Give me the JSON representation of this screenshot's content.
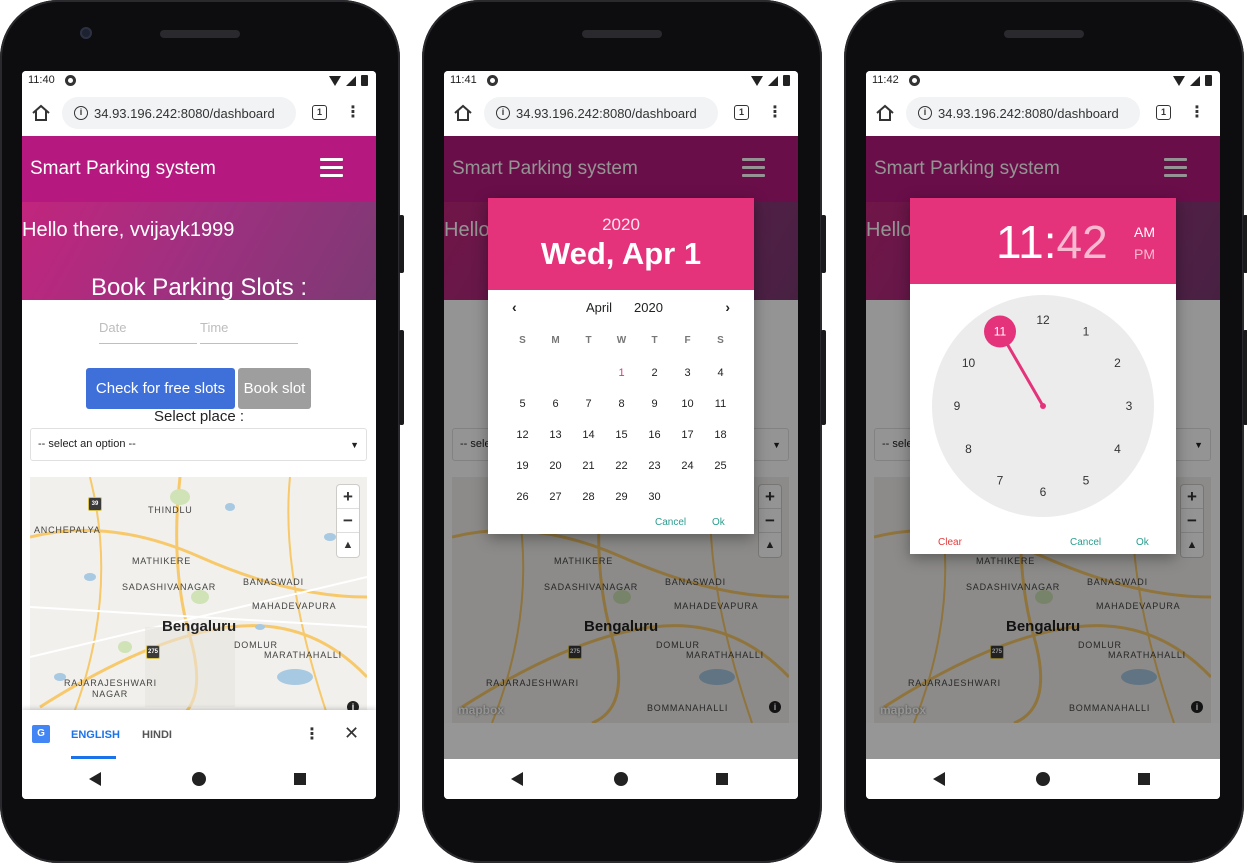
{
  "status_times": [
    "11:40",
    "11:41",
    "11:42"
  ],
  "browser": {
    "url": "34.93.196.242:8080/dashboard",
    "tab_count": "1"
  },
  "app": {
    "title": "Smart Parking system",
    "greeting": "Hello there, vvijayk1999",
    "greeting_partial": "Hello",
    "book_title": "Book Parking Slots :",
    "date_placeholder": "Date",
    "time_placeholder": "Time",
    "check_button": "Check for free slots",
    "book_button": "Book slot",
    "select_label": "Select place :",
    "select_value": "-- select an option --",
    "select_value_partial": "-- sele"
  },
  "map": {
    "city": "Bengaluru",
    "labels": [
      "ANCHEPALYA",
      "THINDLU",
      "MATHIKERE",
      "SADASHIVANAGAR",
      "BANASWADI",
      "MAHADEVAPURA",
      "DOMLUR",
      "MARATHAHALLI",
      "RAJARAJESHWARI",
      "NAGAR",
      "BOMMANAHALLI"
    ],
    "shields": [
      "39",
      "275"
    ],
    "attribution": "mapbox",
    "zoom_in": "+",
    "zoom_out": "−",
    "compass": "▲",
    "info": "i",
    "colors": {
      "water": "#a8c9e2",
      "road_major": "#f7c96a",
      "park": "#cfe3b6"
    }
  },
  "translate": {
    "english": "ENGLISH",
    "hindi": "HINDI"
  },
  "datepicker": {
    "year": "2020",
    "date": "Wed, Apr 1",
    "month": "April",
    "year_select": "2020",
    "weekdays": [
      "S",
      "M",
      "T",
      "W",
      "T",
      "F",
      "S"
    ],
    "days": [
      "",
      "",
      "",
      "1",
      "2",
      "3",
      "4",
      "5",
      "6",
      "7",
      "8",
      "9",
      "10",
      "11",
      "12",
      "13",
      "14",
      "15",
      "16",
      "17",
      "18",
      "19",
      "20",
      "21",
      "22",
      "23",
      "24",
      "25",
      "26",
      "27",
      "28",
      "29",
      "30"
    ],
    "selected_day": "1",
    "cancel": "Cancel",
    "ok": "Ok"
  },
  "timepicker": {
    "hour": "11",
    "minutes": "42",
    "am": "AM",
    "pm": "PM",
    "dial_numbers": [
      "12",
      "1",
      "2",
      "3",
      "4",
      "5",
      "6",
      "7",
      "8",
      "9",
      "10",
      "11"
    ],
    "selected_hour": "11",
    "clear": "Clear",
    "cancel": "Cancel",
    "ok": "Ok"
  },
  "colors": {
    "accent": "#e4337a",
    "appbar": "#b5197f",
    "primary_button": "#3f70d9",
    "secondary_button": "#9e9e9e"
  }
}
